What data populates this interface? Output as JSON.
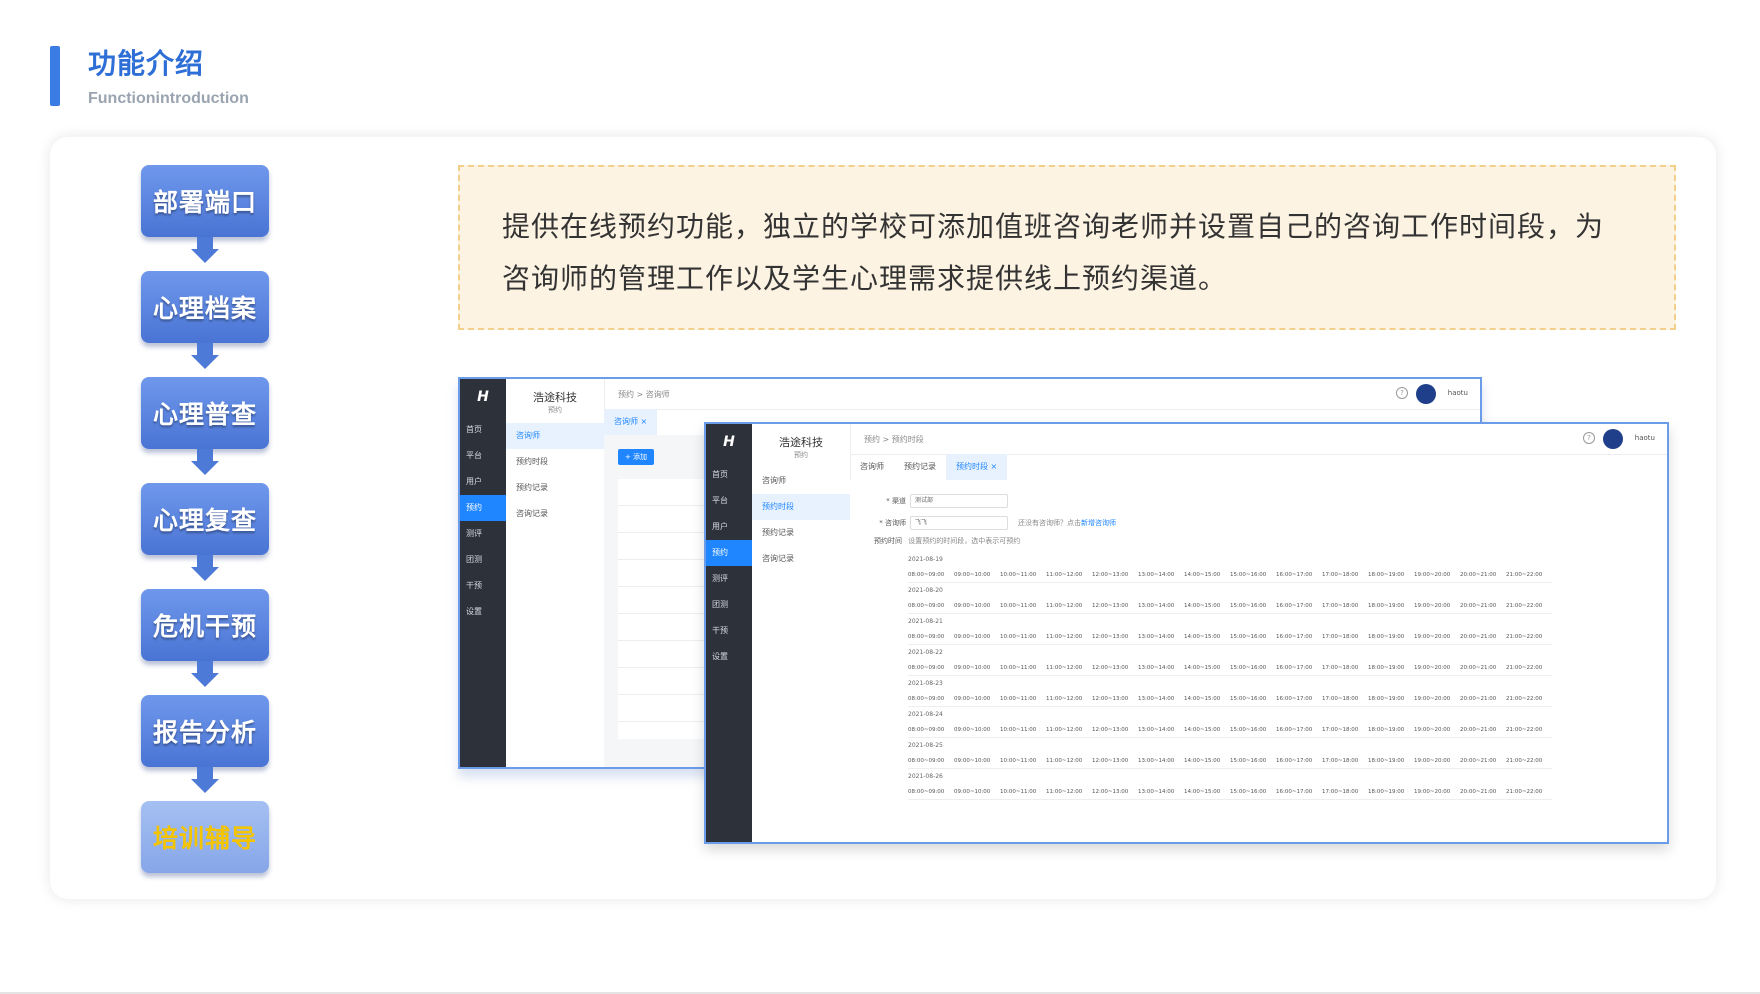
{
  "header": {
    "title": "功能介绍",
    "subtitle": "Functionintroduction"
  },
  "flow": {
    "steps": [
      "部署端口",
      "心理档案",
      "心理普查",
      "心理复查",
      "危机干预",
      "报告分析",
      "培训辅导"
    ],
    "active_index": 6
  },
  "description": "提供在线预约功能，独立的学校可添加值班咨询老师并设置自己的咨询工作时间段，为咨询师的管理工作以及学生心理需求提供线上预约渠道。",
  "app_back": {
    "logo": "H",
    "nav": [
      "首页",
      "平台",
      "用户",
      "预约",
      "测评",
      "团测",
      "干预",
      "设置"
    ],
    "nav_active": 3,
    "org_name": "浩途科技",
    "org_caption": "预约",
    "sub_nav": [
      "咨询师",
      "预约时段",
      "预约记录",
      "咨询记录"
    ],
    "sub_active": 0,
    "breadcrumb": "预约 > 咨询师",
    "tab": "咨询师 ×",
    "add_button": "+ 添加",
    "user": "haotu"
  },
  "app_front": {
    "logo": "H",
    "nav": [
      "首页",
      "平台",
      "用户",
      "预约",
      "测评",
      "团测",
      "干预",
      "设置"
    ],
    "nav_active": 3,
    "org_name": "浩途科技",
    "org_caption": "预约",
    "sub_nav": [
      "咨询师",
      "预约时段",
      "预约记录",
      "咨询记录"
    ],
    "sub_active": 1,
    "breadcrumb": "预约 > 预约时段",
    "tabs": [
      "咨询师",
      "预约记录",
      "预约时段 ×"
    ],
    "tab_active": 2,
    "user": "haotu",
    "form": {
      "channel_label": "* 渠道",
      "channel_value": "测试部",
      "counselor_label": "* 咨询师",
      "counselor_value": "飞飞",
      "hint": "还没有咨询师？点击",
      "hint_link": "新增咨询师",
      "time_label": "预约时间",
      "time_hint": "设置预约的时间段，选中表示可预约"
    },
    "dates": [
      "2021-08-19",
      "2021-08-20",
      "2021-08-21",
      "2021-08-22",
      "2021-08-23",
      "2021-08-24",
      "2021-08-25",
      "2021-08-26"
    ],
    "slots": [
      "08:00~09:00",
      "09:00~10:00",
      "10:00~11:00",
      "11:00~12:00",
      "12:00~13:00",
      "13:00~14:00",
      "14:00~15:00",
      "15:00~16:00",
      "16:00~17:00",
      "17:00~18:00",
      "18:00~19:00",
      "19:00~20:00",
      "20:00~21:00",
      "21:00~22:00"
    ]
  }
}
